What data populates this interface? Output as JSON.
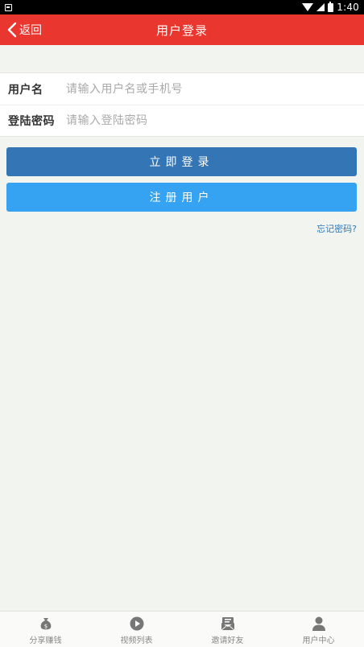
{
  "status_bar": {
    "time": "1:40"
  },
  "header": {
    "back_label": "返回",
    "title": "用户登录"
  },
  "form": {
    "username_label": "用户名",
    "username_placeholder": "请输入用户名或手机号",
    "password_label": "登陆密码",
    "password_placeholder": "请输入登陆密码"
  },
  "buttons": {
    "login": "立即登录",
    "register": "注册用户"
  },
  "forgot_password": "忘记密码?",
  "colors": {
    "header": "#e9372f",
    "login_button": "#3475b6",
    "register_button": "#35a3f2",
    "background": "#f2f4ef"
  },
  "bottom_nav": [
    {
      "label": "分享赚钱",
      "icon": "money-bag-icon"
    },
    {
      "label": "视频列表",
      "icon": "play-circle-icon"
    },
    {
      "label": "邀请好友",
      "icon": "invite-mail-icon"
    },
    {
      "label": "用户中心",
      "icon": "user-icon"
    }
  ]
}
